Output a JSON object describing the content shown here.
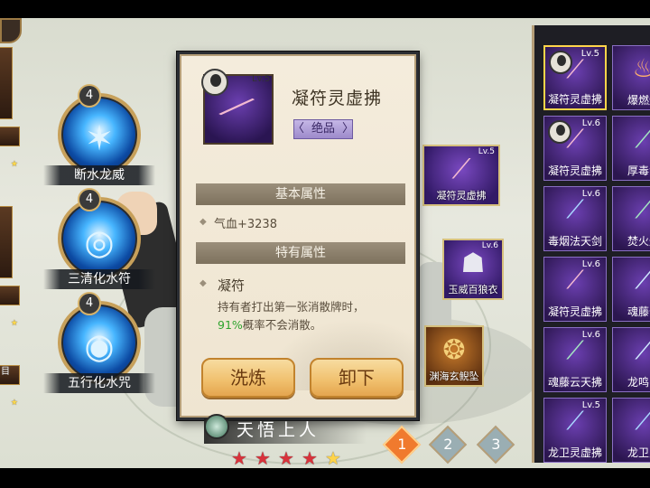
{
  "left_strip": {
    "card_label": "目"
  },
  "skills": [
    {
      "name": "断水龙威",
      "level": "4"
    },
    {
      "name": "三清化水符",
      "level": "4"
    },
    {
      "name": "五行化水咒",
      "level": "4"
    }
  ],
  "popup": {
    "item_level": "Lv.5",
    "item_name": "凝符灵虚拂",
    "grade": "绝品",
    "basic_section": "基本属性",
    "basic_attr": "气血+3238",
    "special_section": "特有属性",
    "feature_title": "凝符",
    "feature_desc_prefix": "持有者打出第一张消散牌时，",
    "feature_percent": "91%",
    "feature_desc_suffix": "概率不会消散。",
    "btn_refine": "洗炼",
    "btn_unequip": "卸下"
  },
  "equipped": [
    {
      "name": "凝符灵虚拂",
      "level": "Lv.5"
    },
    {
      "name": "玉威百狼衣",
      "level": "Lv.6"
    },
    {
      "name": "渊海玄鲵坠",
      "level": ""
    }
  ],
  "hero": {
    "name": "天悟上人",
    "stars_red": 4,
    "stars_gold": 1
  },
  "pages": [
    "1",
    "2",
    "3"
  ],
  "inventory": [
    {
      "name": "凝符灵虚拂",
      "level": "Lv.5",
      "avatar": true,
      "selected": true,
      "icon": "whisk-icon"
    },
    {
      "name": "爆燃焰",
      "level": "",
      "avatar": false,
      "selected": false,
      "icon": "flame-icon"
    },
    {
      "name": "凝符灵虚拂",
      "level": "Lv.6",
      "avatar": true,
      "selected": false,
      "icon": "whisk-icon"
    },
    {
      "name": "厚毒法",
      "level": "",
      "avatar": false,
      "selected": false,
      "icon": "sword-icon"
    },
    {
      "name": "毒烟法天剑",
      "level": "Lv.6",
      "avatar": false,
      "selected": false,
      "icon": "sword-icon"
    },
    {
      "name": "焚火灼",
      "level": "",
      "avatar": false,
      "selected": false,
      "icon": "sword-icon"
    },
    {
      "name": "凝符灵虚拂",
      "level": "Lv.6",
      "avatar": false,
      "selected": false,
      "icon": "whisk-icon"
    },
    {
      "name": "魂藤云",
      "level": "",
      "avatar": false,
      "selected": false,
      "icon": "sword-icon"
    },
    {
      "name": "魂藤云天拂",
      "level": "Lv.6",
      "avatar": false,
      "selected": false,
      "icon": "whisk-icon"
    },
    {
      "name": "龙鸣断",
      "level": "",
      "avatar": false,
      "selected": false,
      "icon": "sword-icon"
    },
    {
      "name": "龙卫灵虚拂",
      "level": "Lv.5",
      "avatar": false,
      "selected": false,
      "icon": "whisk-icon"
    },
    {
      "name": "龙卫灵",
      "level": "",
      "avatar": false,
      "selected": false,
      "icon": "whisk-icon"
    }
  ]
}
